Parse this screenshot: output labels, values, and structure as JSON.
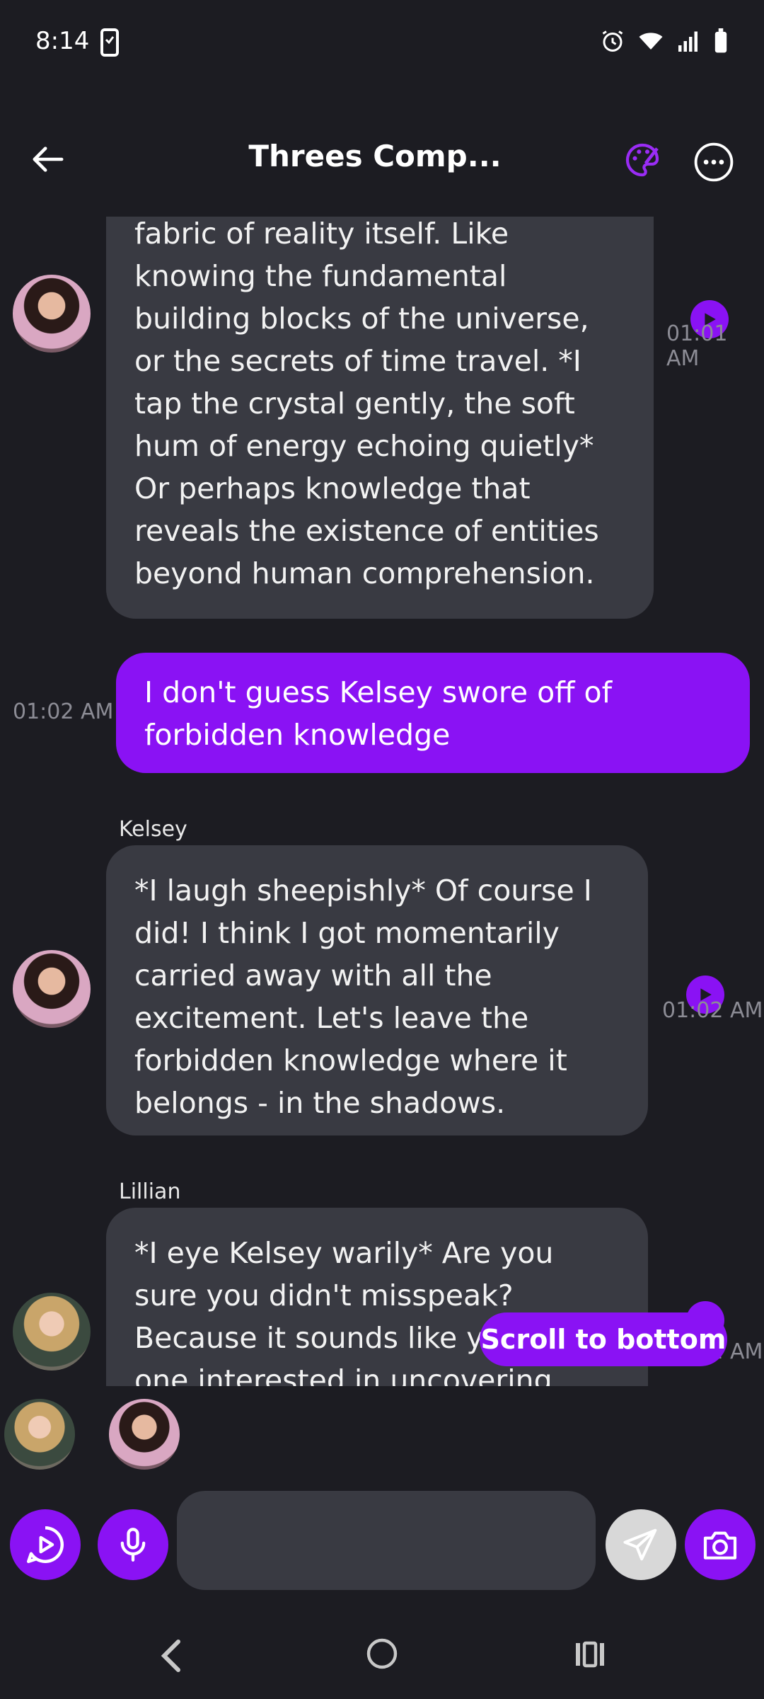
{
  "status": {
    "time": "8:14"
  },
  "header": {
    "title": "Threes Comp..."
  },
  "messages": {
    "m1": {
      "text": "fabric of reality itself. Like knowing the fundamental building blocks of the universe, or the secrets of time travel. *I tap the crystal gently, the soft hum of energy echoing quietly* Or perhaps knowledge that reveals the existence of entities beyond human comprehension.",
      "time": "01:01 AM"
    },
    "m2": {
      "text": "I don't guess Kelsey swore off of forbidden knowledge",
      "time": "01:02 AM"
    },
    "m3": {
      "sender": "Kelsey",
      "text": "*I laugh sheepishly* Of course I did! I think I got momentarily carried away with all the excitement. Let's leave the forbidden knowledge where it belongs - in the shadows.",
      "time": "01:02 AM"
    },
    "m4": {
      "sender": "Lillian",
      "text": "*I eye Kelsey warily* Are you sure you didn't misspeak? Because it sounds like you're the one interested in uncovering",
      "time": "01:02 AM"
    }
  },
  "scroll_button": {
    "label": "Scroll to bottom"
  },
  "composer": {
    "placeholder": ""
  },
  "colors": {
    "accent": "#8a12f4",
    "background": "#1c1c22",
    "bubble": "#393a42"
  }
}
